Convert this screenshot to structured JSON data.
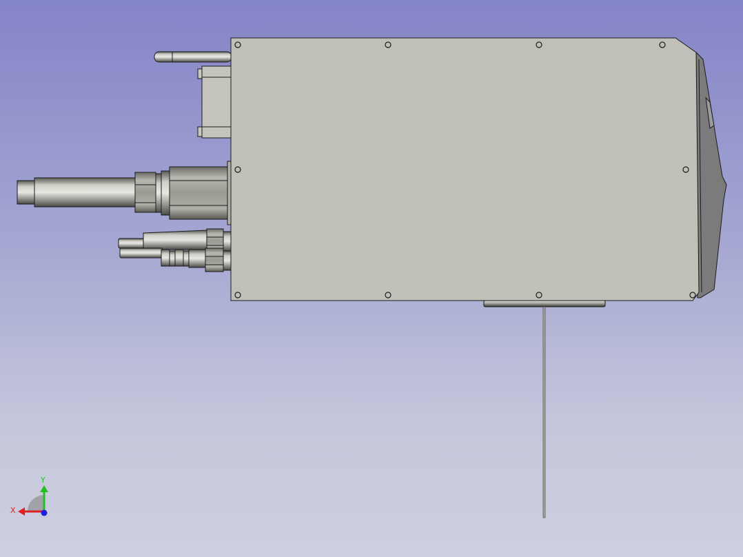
{
  "view": {
    "background_top": "#8484c8",
    "background_bottom": "#cecfde",
    "part_color": "#c0c0b8",
    "side_face_color": "#7b7b7b",
    "metal_color": "#a0a09a",
    "edge_color": "#1a1a1a"
  },
  "axis_triad": {
    "x_label": "X",
    "y_label": "Y",
    "x_color": "#e02020",
    "y_color": "#20c020",
    "z_color": "#2020e0"
  }
}
